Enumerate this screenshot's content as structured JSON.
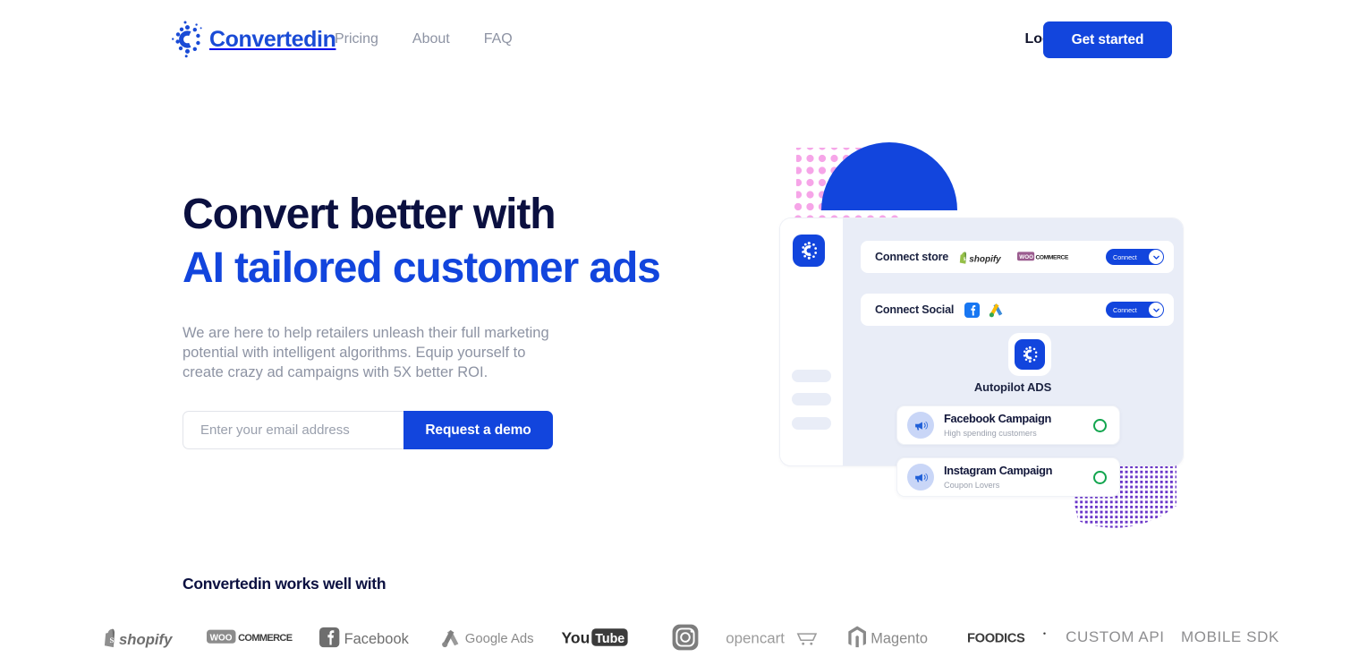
{
  "header": {
    "brand": {
      "name": "Convertedin",
      "logo_icon": "convertedin-gear-c-logo",
      "color": "#1a4bd6"
    },
    "nav": [
      {
        "label": "Pricing"
      },
      {
        "label": "About"
      },
      {
        "label": "FAQ"
      }
    ],
    "login_label": "Login",
    "get_started_label": "Get started",
    "accent_color": "#1245dd"
  },
  "hero": {
    "title_line1": "Convert better with",
    "title_line2": "AI tailored customer ads",
    "title_line1_color": "#0b1040",
    "title_line2_color": "#1245dd",
    "subtitle": "We are here to help retailers unleash their full marketing potential with intelligent algorithms. Equip yourself to create crazy ad campaigns with 5X better ROI.",
    "email_placeholder": "Enter your email address",
    "email_value": "",
    "demo_button_label": "Request a demo"
  },
  "illustration": {
    "sidebar_logo_icon": "convertedin-gear-c-logo",
    "connect_rows": [
      {
        "label": "Connect store",
        "logos": [
          "shopify-logo",
          "woocommerce-logo"
        ],
        "button_label": "Connect",
        "chevron_icon": "chevron-down-icon"
      },
      {
        "label": "Connect Social",
        "logos": [
          "facebook-logo",
          "google-ads-logo"
        ],
        "button_label": "Connect",
        "chevron_icon": "chevron-down-icon"
      }
    ],
    "autopilot_badge_icon": "convertedin-gear-c-logo",
    "autopilot_title": "Autopilot ADS",
    "campaigns": [
      {
        "icon": "megaphone-icon",
        "name": "Facebook Campaign",
        "description": "High spending customers",
        "status_icon": "status-ring-icon",
        "status_color": "#12a54e"
      },
      {
        "icon": "megaphone-icon",
        "name": "Instagram Campaign",
        "description": "Coupon Lovers",
        "status_icon": "status-ring-icon",
        "status_color": "#12a54e"
      }
    ],
    "decor": {
      "dome_color": "#1245dd",
      "pink_dots_color": "#f6a5e8",
      "purple_dots_color": "#6a35c9"
    }
  },
  "partners": {
    "title": "Convertedin works well with",
    "logos": [
      {
        "name": "shopify-logo",
        "label": "shopify"
      },
      {
        "name": "woocommerce-logo",
        "label": "WOO COMMERCE"
      },
      {
        "name": "facebook-logo",
        "label": "Facebook"
      },
      {
        "name": "google-ads-logo",
        "label": "Google Ads"
      },
      {
        "name": "youtube-logo",
        "label": "You Tube"
      },
      {
        "name": "instagram-logo",
        "label": ""
      },
      {
        "name": "opencart-logo",
        "label": "opencart"
      },
      {
        "name": "magento-logo",
        "label": "Magento"
      },
      {
        "name": "foodics-logo",
        "label": "FOODICS"
      },
      {
        "name": "custom-api-label",
        "label": "CUSTOM API"
      },
      {
        "name": "mobile-sdk-label",
        "label": "MOBILE SDK"
      }
    ]
  }
}
